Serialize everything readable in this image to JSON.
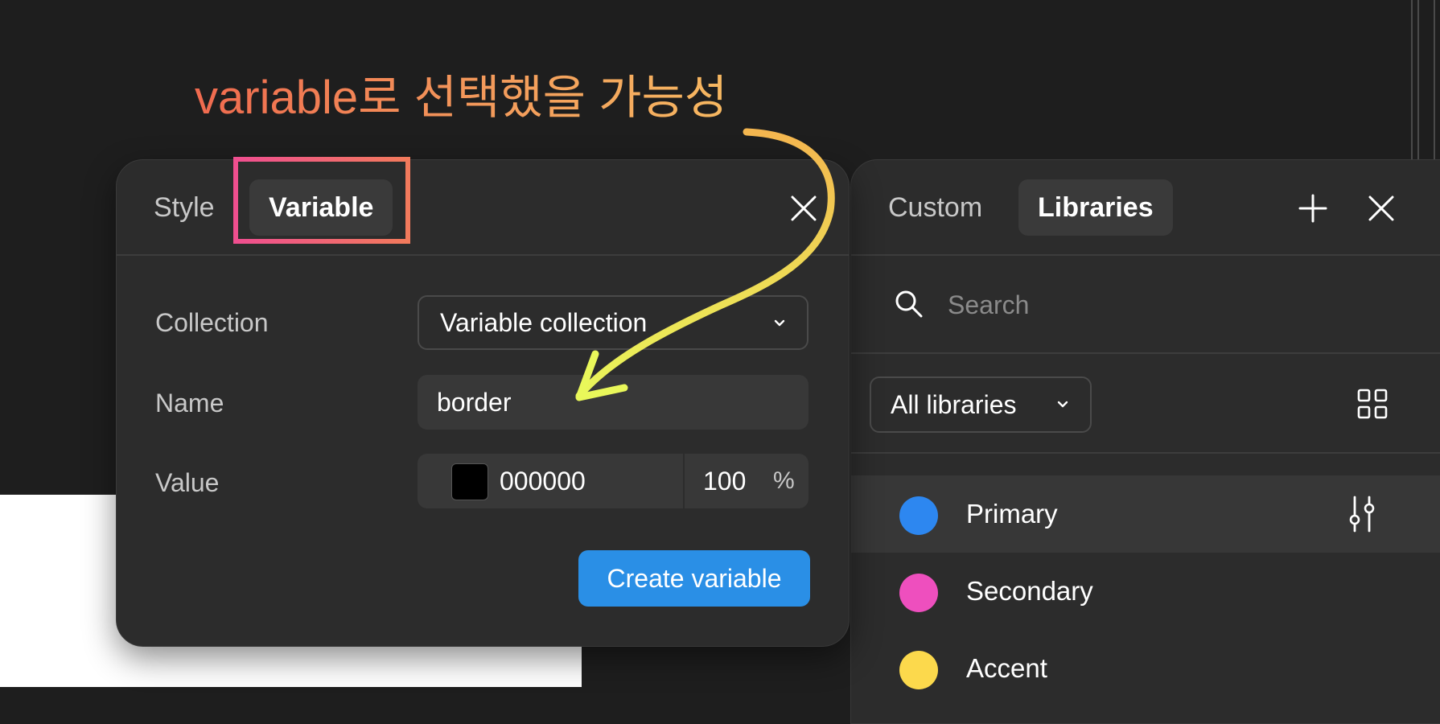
{
  "annotation": {
    "text": "variable로 선택했을 가능성"
  },
  "left_panel": {
    "tabs": [
      {
        "label": "Style",
        "active": false
      },
      {
        "label": "Variable",
        "active": true
      }
    ],
    "fields": {
      "collection": {
        "label": "Collection",
        "value": "Variable collection"
      },
      "name": {
        "label": "Name",
        "value": "border"
      },
      "value": {
        "label": "Value",
        "hex": "000000",
        "opacity": "100",
        "unit": "%",
        "swatch_color": "#000000"
      }
    },
    "create_button": "Create variable"
  },
  "right_panel": {
    "tabs": [
      {
        "label": "Custom",
        "active": false
      },
      {
        "label": "Libraries",
        "active": true
      }
    ],
    "search": {
      "placeholder": "Search"
    },
    "library_filter": "All libraries",
    "items": [
      {
        "label": "Primary",
        "color": "#2d87f0",
        "selected": true
      },
      {
        "label": "Secondary",
        "color": "#ee4fbe",
        "selected": false
      },
      {
        "label": "Accent",
        "color": "#fcd94c",
        "selected": false
      }
    ]
  },
  "colors": {
    "highlight_box": "#ef4f8f",
    "arrow": "#e8f25a",
    "primary_button": "#2a8fe6"
  }
}
